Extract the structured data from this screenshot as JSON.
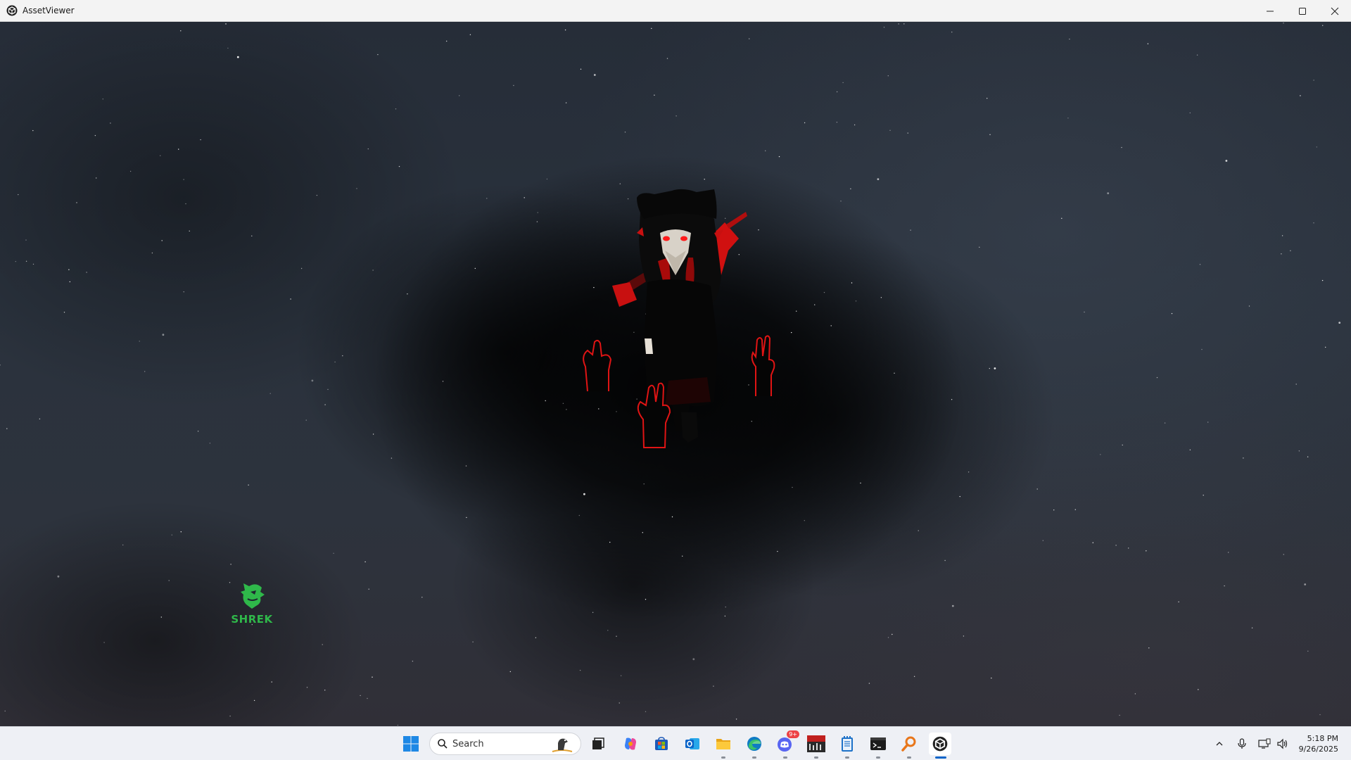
{
  "window": {
    "title": "AssetViewer",
    "controls": {
      "minimize": "minimize-icon",
      "maximize": "maximize-icon",
      "close": "close-icon"
    }
  },
  "viewport": {
    "logo_text": "SHREK",
    "colors": {
      "logo": "#2fb84a",
      "accent_red": "#e01414"
    }
  },
  "taskbar": {
    "search_placeholder": "Search",
    "apps": [
      {
        "name": "start",
        "icon": "windows-icon"
      },
      {
        "name": "task-view",
        "icon": "task-view-icon"
      },
      {
        "name": "copilot",
        "icon": "copilot-icon"
      },
      {
        "name": "microsoft-store",
        "icon": "store-icon"
      },
      {
        "name": "outlook",
        "icon": "outlook-icon"
      },
      {
        "name": "file-explorer",
        "icon": "folder-icon"
      },
      {
        "name": "edge",
        "icon": "edge-icon"
      },
      {
        "name": "discord",
        "icon": "discord-icon",
        "badge": "9+"
      },
      {
        "name": "voicemeeter",
        "icon": "voicemeeter-icon",
        "label": "VOICE METER"
      },
      {
        "name": "notepad",
        "icon": "notepad-icon"
      },
      {
        "name": "terminal",
        "icon": "terminal-icon"
      },
      {
        "name": "search-tool",
        "icon": "magnifier-icon"
      },
      {
        "name": "assetviewer",
        "icon": "unity-icon"
      }
    ],
    "tray": {
      "time": "5:18 PM",
      "date": "9/26/2025"
    }
  }
}
